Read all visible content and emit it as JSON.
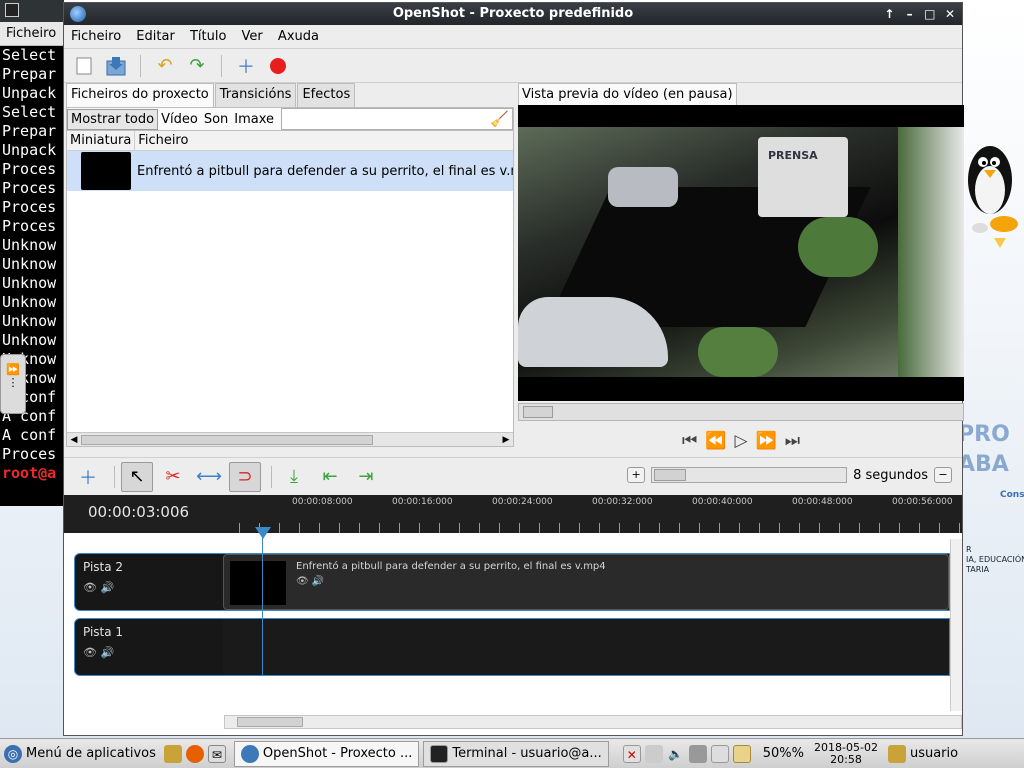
{
  "terminal": {
    "menu": "Ficheiro",
    "lines": [
      "Select",
      "Prepar",
      "Unpack",
      "Select",
      "Prepar",
      "Unpack",
      "Proces",
      "Proces",
      "Proces",
      "Proces",
      "Unknow",
      "Unknow",
      "Unknow",
      "Unknow",
      "Unknow",
      "Unknow",
      "Unknow",
      "Unknow",
      "A conf",
      "A conf",
      "A conf",
      "Proces"
    ],
    "prompt": "root@a"
  },
  "window": {
    "title": "OpenShot - Proxecto predefinido",
    "menu": [
      "Ficheiro",
      "Editar",
      "Título",
      "Ver",
      "Axuda"
    ]
  },
  "tabs": [
    "Ficheiros do proxecto",
    "Transicións",
    "Efectos"
  ],
  "filters": [
    "Mostrar todo",
    "Vídeo",
    "Son",
    "Imaxe"
  ],
  "file_list": {
    "columns": [
      "Miniatura",
      "Ficheiro"
    ],
    "rows": [
      {
        "file": "Enfrentó a pitbull para defender a su perrito, el final es v.mp4"
      }
    ]
  },
  "preview": {
    "tab": "Vista previa do vídeo (en pausa)",
    "truck_text": "PRENSA"
  },
  "timeline": {
    "zoom_label": "8 segundos",
    "current_time": "00:00:03:006",
    "ticks": [
      "00:00:08:000",
      "00:00:16:000",
      "00:00:24:000",
      "00:00:32:000",
      "00:00:40:000",
      "00:00:48:000",
      "00:00:56:000"
    ],
    "tracks": [
      {
        "name": "Pista 2",
        "clip": "Enfrentó a pitbull para defender a su perrito, el final es v.mp4"
      },
      {
        "name": "Pista 1",
        "clip": ""
      }
    ]
  },
  "desktop": {
    "logo_text": "PRO\nABA",
    "side_text": "Cons",
    "small_text": "R\nIA, EDUCACIÓN\nTARIA"
  },
  "taskbar": {
    "menu": "Menú de aplicativos",
    "windows": [
      "OpenShot - Proxecto ...",
      "Terminal - usuario@a..."
    ],
    "battery": "50%%",
    "date": "2018-05-02",
    "time": "20:58",
    "user": "usuario"
  },
  "colors": {
    "accent": "#3a89c9",
    "selection": "#cde0f7",
    "record": "#e81e1e"
  }
}
